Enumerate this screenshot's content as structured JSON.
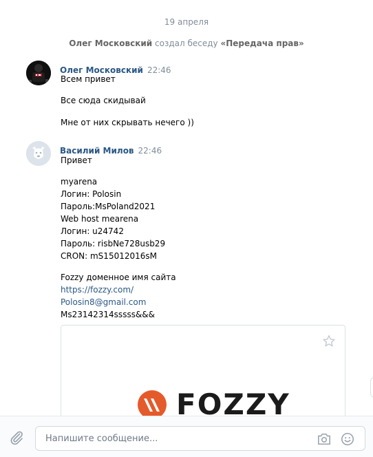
{
  "feed": {
    "date": "19 апреля",
    "service": {
      "actor": "Олег Московский",
      "action": "создал беседу",
      "chat_name": "«Передача прав»"
    },
    "messages": [
      {
        "author": "Олег Московский",
        "time": "22:46",
        "avatar": "avatar-oleg",
        "lines": [
          "Всем привет",
          "Все сюда скидывай",
          "Мне от них скрывать нечего ))"
        ]
      },
      {
        "author": "Василий Милов",
        "time": "22:46",
        "avatar": "avatar-vasiliy-dog",
        "lines": [
          "Привет",
          "myarena",
          "Логин: Polosin",
          "Пароль:MsPoland2021",
          "Web host mearena",
          "Логин: u24742",
          "Пароль: risbNe728usb29",
          "CRON: mS15012016sM",
          "Fozzy доменное имя сайта",
          "https://fozzy.com/",
          "Polosin8@gmail.com",
          "Ms23142314sssss&&&"
        ]
      }
    ],
    "link_preview": {
      "brand": "FOZZY",
      "favorite_icon": "star-icon",
      "brand_color": "#e55a2b"
    }
  },
  "composer": {
    "placeholder": "Напишите сообщение...",
    "attach_icon": "paperclip-icon",
    "camera_icon": "camera-icon",
    "emoji_icon": "smile-icon"
  },
  "colors": {
    "link": "#2a5885",
    "meta": "#818c99"
  }
}
